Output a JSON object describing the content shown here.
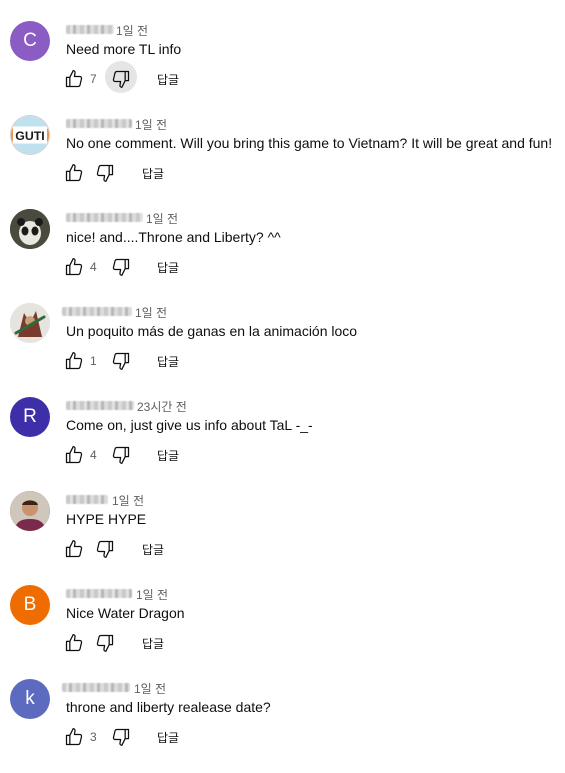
{
  "comments": [
    {
      "avatar_letter": "C",
      "avatar_color": "#8a5cc4",
      "time": "1일 전",
      "text": "Need more TL info",
      "likes": "7",
      "reply_label": "답글"
    },
    {
      "avatar_letter": "GUTI",
      "avatar_color": "#ffffff",
      "time": "1일 전",
      "text": "No one comment. Will you bring this game to Vietnam? It will be great and fun!",
      "likes": "",
      "reply_label": "답글"
    },
    {
      "avatar_letter": "",
      "avatar_color": "#2e2e2e",
      "time": "1일 전",
      "text": "nice! and....Throne and Liberty? ^^",
      "likes": "4",
      "reply_label": "답글"
    },
    {
      "avatar_letter": "",
      "avatar_color": "#8a4a3a",
      "time": "1일 전",
      "text": "Un poquito más de ganas en la animación loco",
      "likes": "1",
      "reply_label": "답글"
    },
    {
      "avatar_letter": "R",
      "avatar_color": "#3d2fa8",
      "time": "23시간 전",
      "text": "Come on, just give us info about TaL -_-",
      "likes": "4",
      "reply_label": "답글"
    },
    {
      "avatar_letter": "",
      "avatar_color": "#6b4a3a",
      "time": "1일 전",
      "text": "HYPE HYPE",
      "likes": "",
      "reply_label": "답글"
    },
    {
      "avatar_letter": "B",
      "avatar_color": "#ef6c00",
      "time": "1일 전",
      "text": "Nice Water Dragon",
      "likes": "",
      "reply_label": "답글"
    },
    {
      "avatar_letter": "k",
      "avatar_color": "#5c6bc0",
      "time": "1일 전",
      "text": "throne and liberty realease date?",
      "likes": "3",
      "reply_label": "답글"
    }
  ]
}
